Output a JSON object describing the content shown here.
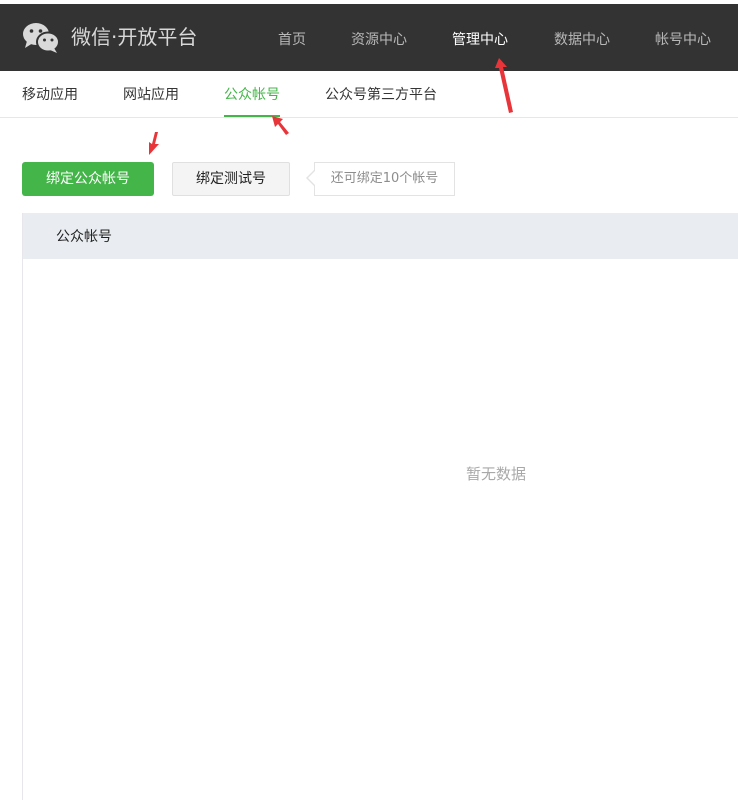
{
  "header": {
    "brand": "微信·开放平台",
    "nav": [
      "首页",
      "资源中心",
      "管理中心",
      "数据中心",
      "帐号中心"
    ],
    "active_nav": "管理中心"
  },
  "subnav": {
    "items": [
      "移动应用",
      "网站应用",
      "公众帐号",
      "公众号第三方平台"
    ],
    "active": "公众帐号"
  },
  "actions": {
    "bind_official": "绑定公众帐号",
    "bind_test": "绑定测试号",
    "remaining_tip": "还可绑定10个帐号"
  },
  "table": {
    "columns": [
      "公众帐号"
    ],
    "empty_text": "暂无数据"
  },
  "colors": {
    "header_bg": "#333333",
    "accent": "#44b549",
    "annotation": "#e8353a"
  },
  "icons": {
    "logo": "wechat-logo-icon"
  }
}
